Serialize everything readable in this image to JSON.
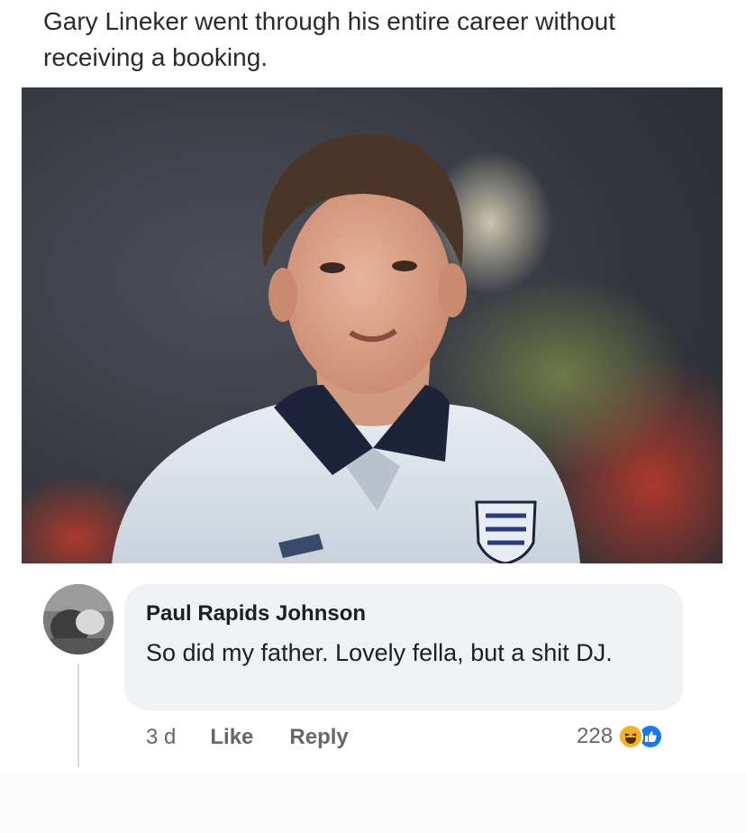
{
  "post": {
    "text": "Gary Lineker went through his entire career without receiving a booking."
  },
  "comment": {
    "author": "Paul Rapids Johnson",
    "text": "So did my father. Lovely fella,  but a shit DJ.",
    "time": "3 d",
    "like_label": "Like",
    "reply_label": "Reply",
    "reaction_count": "228",
    "reactions": [
      "haha-icon",
      "like-icon"
    ]
  },
  "colors": {
    "bubble": "#eff1f4",
    "meta_text": "#65676b",
    "like_blue": "#1877f2",
    "haha_yellow": "#f7b125"
  }
}
